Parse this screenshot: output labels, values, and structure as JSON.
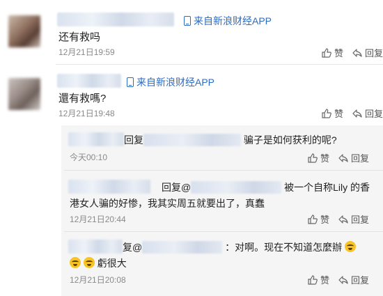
{
  "comments": [
    {
      "source": "来自新浪财经APP",
      "text": "还有救吗",
      "time": "12月21日19:59",
      "like": "赞",
      "reply": "回复"
    },
    {
      "source": "来自新浪财经APP",
      "text": "還有救嗎?",
      "time": "12月21日19:48",
      "like": "赞",
      "reply": "回复",
      "replies": [
        {
          "prefix": "回复",
          "text": "骗子是如何获利的呢?",
          "time": "今天00:10",
          "like": "赞",
          "reply": "回复"
        },
        {
          "prefix": "回复@",
          "text_line1": "被一个自称Lily 的香",
          "text_line2": "港女人骗的好惨，我其实周五就要出了，真蠢",
          "time": "12月21日20:44",
          "like": "赞",
          "reply": "回复"
        },
        {
          "prefix": "复@",
          "text_line1": "：对啊。现在不知道怎麼辦",
          "text_line2": "虧很大",
          "time": "12月21日20:08",
          "like": "赞",
          "reply": "回复"
        }
      ]
    }
  ],
  "icons": {
    "like": "thumbs-up-icon",
    "reply": "reply-arrow-icon",
    "source": "phone-icon",
    "emoji": "crying-face-icon"
  }
}
